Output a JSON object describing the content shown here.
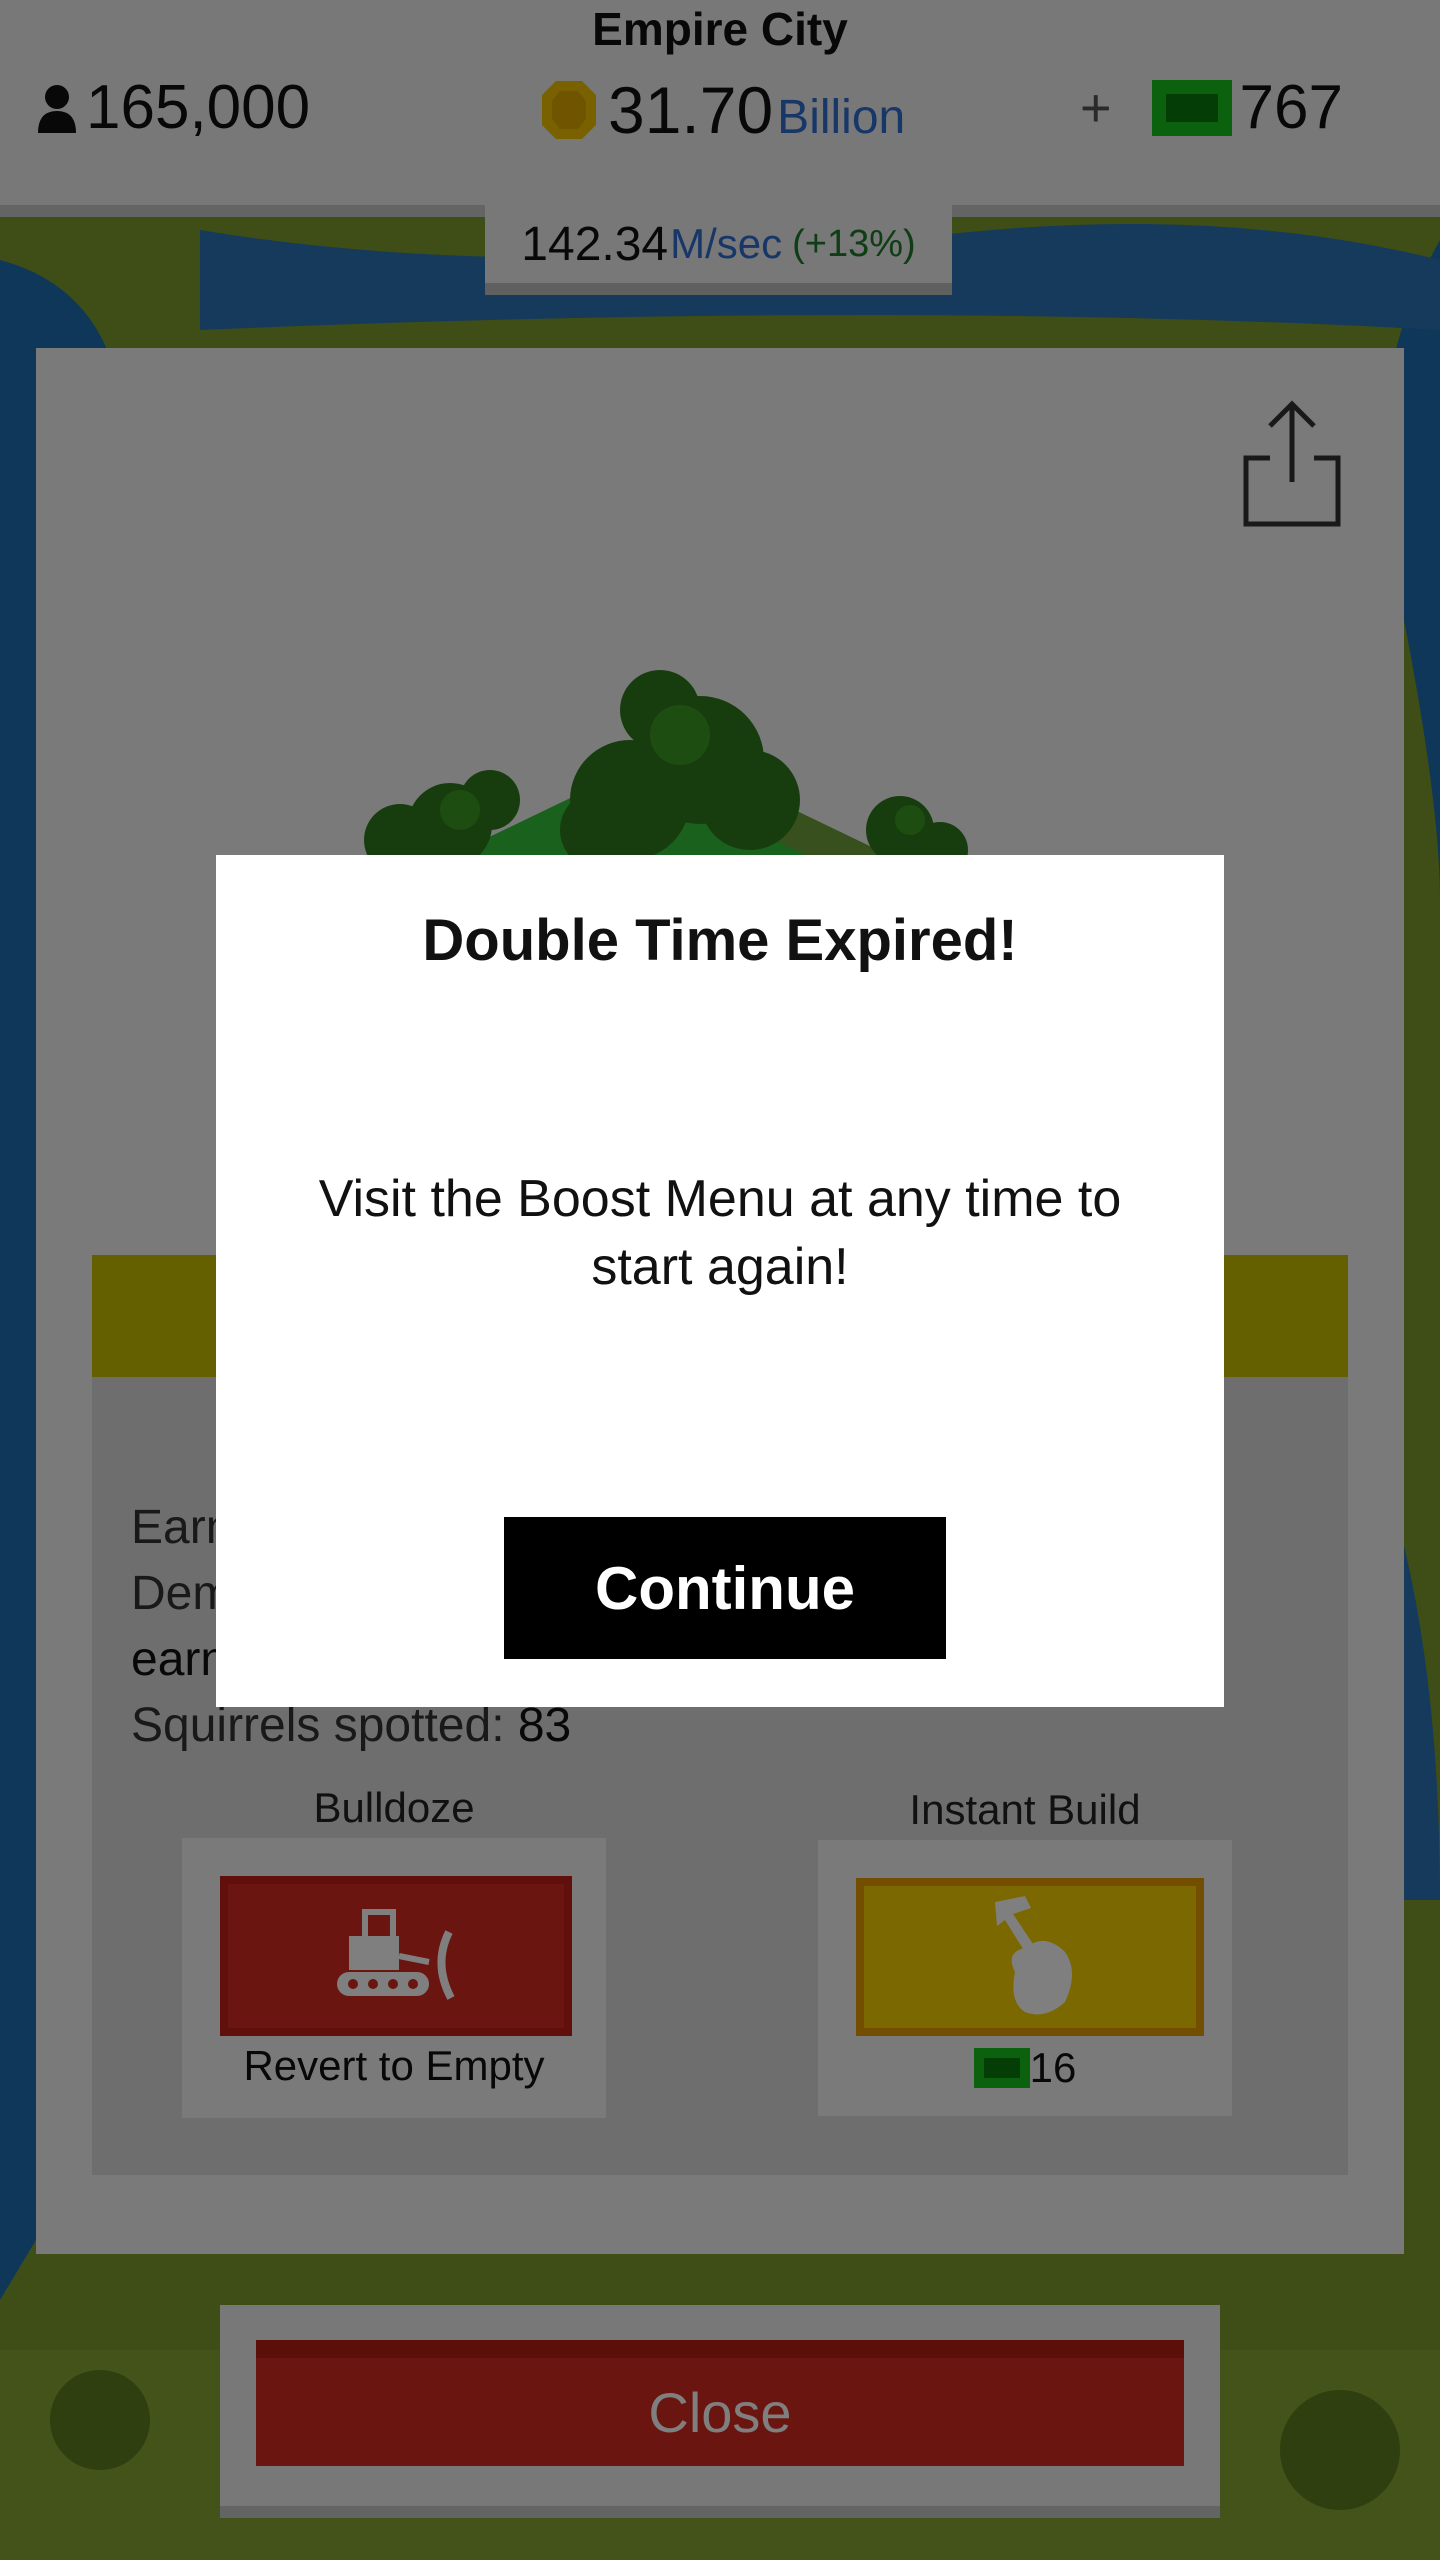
{
  "hud": {
    "city_name": "Empire City",
    "population": "165,000",
    "money_value": "31.70",
    "money_unit": "Billion",
    "gems_plus": "+",
    "gems": "767",
    "rate_value": "142.34",
    "rate_unit": "M/sec",
    "rate_bonus": "(+13%)"
  },
  "card": {
    "lines": {
      "earn_prefix": "Earn",
      "dem_prefix": "Dem",
      "earn2_prefix": "earn",
      "squirrels_label": "Squirrels spotted: ",
      "squirrels_value": "83"
    },
    "bulldoze": {
      "title": "Bulldoze",
      "sub": "Revert to Empty"
    },
    "instant": {
      "title": "Instant Build",
      "cost": "16"
    },
    "close_label": "Close"
  },
  "modal": {
    "title": "Double Time Expired!",
    "message": "Visit the Boost Menu at any time to start again!",
    "continue_label": "Continue"
  },
  "colors": {
    "money_unit": "#2f6fd1",
    "rate_bonus": "#1f7a2a",
    "red_button": "#d42a1e",
    "yellow_button": "#f6d000",
    "gem": "#19c21c"
  },
  "icons": [
    "person-icon",
    "coin-icon",
    "gem-icon",
    "share-icon",
    "bulldozer-icon",
    "hammer-hand-icon"
  ]
}
